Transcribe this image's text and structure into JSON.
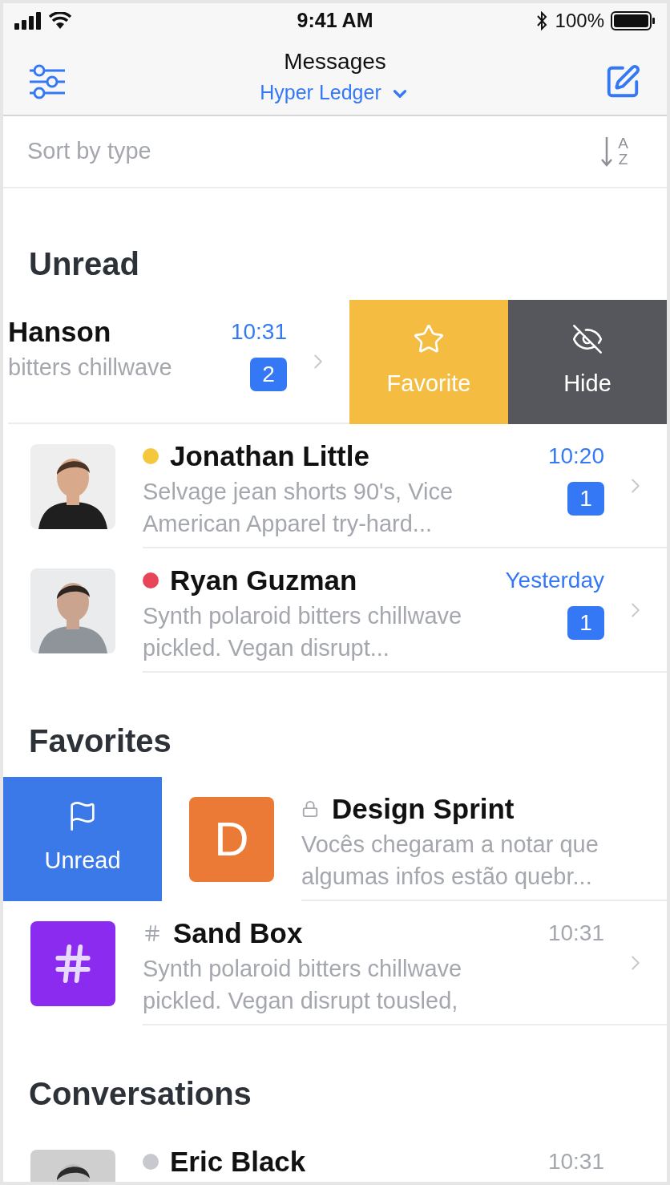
{
  "status_bar": {
    "time": "9:41 AM",
    "battery": "100%"
  },
  "nav": {
    "title": "Messages",
    "subtitle": "Hyper Ledger"
  },
  "sort": {
    "label": "Sort by type",
    "from": "A",
    "to": "Z"
  },
  "sections": [
    {
      "title": "Unread",
      "rows": [
        {
          "kind": "person",
          "name": "Hanson",
          "preview_lines": [
            "bitters chillwave"
          ],
          "time": "10:31",
          "unread": true,
          "badge": "2",
          "chevron": true,
          "actions_right": [
            {
              "kind": "favorite",
              "label": "Favorite"
            },
            {
              "kind": "hide",
              "label": "Hide"
            }
          ]
        },
        {
          "kind": "person",
          "color": "#f5c73d",
          "avatar": {
            "kind": "picture"
          },
          "name": "Jonathan Little",
          "preview_lines": [
            "Selvage jean shorts 90's, Vice",
            "American Apparel try-hard..."
          ],
          "time": "10:20",
          "unread": true,
          "badge": "1",
          "chevron": true
        },
        {
          "kind": "person",
          "color": "#e8445a",
          "avatar": {
            "kind": "picture"
          },
          "name": "Ryan Guzman",
          "preview_lines": [
            "Synth polaroid bitters chillwave",
            "pickled. Vegan disrupt..."
          ],
          "time": "Yesterday",
          "unread": true,
          "badge": "1",
          "chevron": true
        }
      ]
    },
    {
      "title": "Favorites",
      "rows": [
        {
          "kind": "private",
          "avatar": {
            "kind": "letter",
            "text": "D",
            "color": "#ea7a35"
          },
          "name": "Design Sprint",
          "preview_lines": [
            "Vocês chegaram a notar que",
            "algumas infos estão quebr..."
          ],
          "chevron": false,
          "actions_left": [
            {
              "kind": "unread",
              "label": "Unread"
            }
          ]
        },
        {
          "kind": "public",
          "avatar": {
            "kind": "hash",
            "color": "#8a2bef"
          },
          "name": "Sand Box",
          "preview_lines": [
            "Synth polaroid bitters chillwave",
            "pickled. Vegan disrupt tousled,"
          ],
          "time": "10:31",
          "unread": false,
          "chevron": true
        }
      ]
    },
    {
      "title": "Conversations",
      "rows": [
        {
          "kind": "person",
          "color": "#c8c9ce",
          "avatar": {
            "kind": "picture"
          },
          "name": "Eric Black",
          "time": "10:31",
          "unread": false,
          "chevron": false
        }
      ]
    }
  ]
}
